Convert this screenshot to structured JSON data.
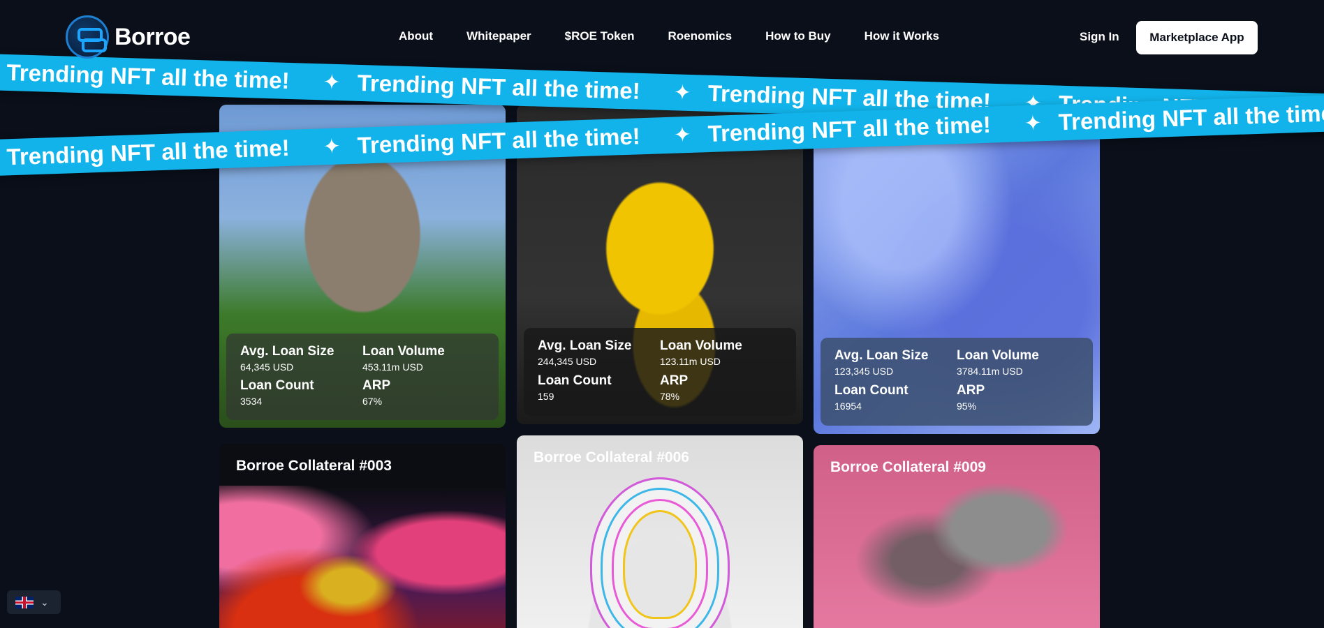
{
  "header": {
    "logo_text": "Borroe",
    "nav": [
      "About",
      "Whitepaper",
      "$ROE Token",
      "Roenomics",
      "How to Buy",
      "How it Works"
    ],
    "sign_in": "Sign In",
    "marketplace_button": "Marketplace App"
  },
  "ribbon": {
    "text": "Trending NFT all the time!",
    "star": "✦"
  },
  "cards": [
    {
      "avg_loan_size_label": "Avg. Loan Size",
      "avg_loan_size": "64,345 USD",
      "loan_volume_label": "Loan Volume",
      "loan_volume": "453.11m USD",
      "loan_count_label": "Loan Count",
      "loan_count": "3534",
      "arp_label": "ARP",
      "arp": "67%"
    },
    {
      "avg_loan_size_label": "Avg. Loan Size",
      "avg_loan_size": "244,345 USD",
      "loan_volume_label": "Loan Volume",
      "loan_volume": "123.11m USD",
      "loan_count_label": "Loan Count",
      "loan_count": "159",
      "arp_label": "ARP",
      "arp": "78%"
    },
    {
      "avg_loan_size_label": "Avg. Loan Size",
      "avg_loan_size": "123,345 USD",
      "loan_volume_label": "Loan Volume",
      "loan_volume": "3784.11m USD",
      "loan_count_label": "Loan Count",
      "loan_count": "16954",
      "arp_label": "ARP",
      "arp": "95%"
    }
  ],
  "collateral_cards": [
    {
      "title": "Borroe Collateral #003"
    },
    {
      "title": "Borroe Collateral #006"
    },
    {
      "title": "Borroe Collateral #009"
    }
  ],
  "language": {
    "icon": "uk-flag-icon",
    "selector_icon": "chevron-down-icon"
  }
}
